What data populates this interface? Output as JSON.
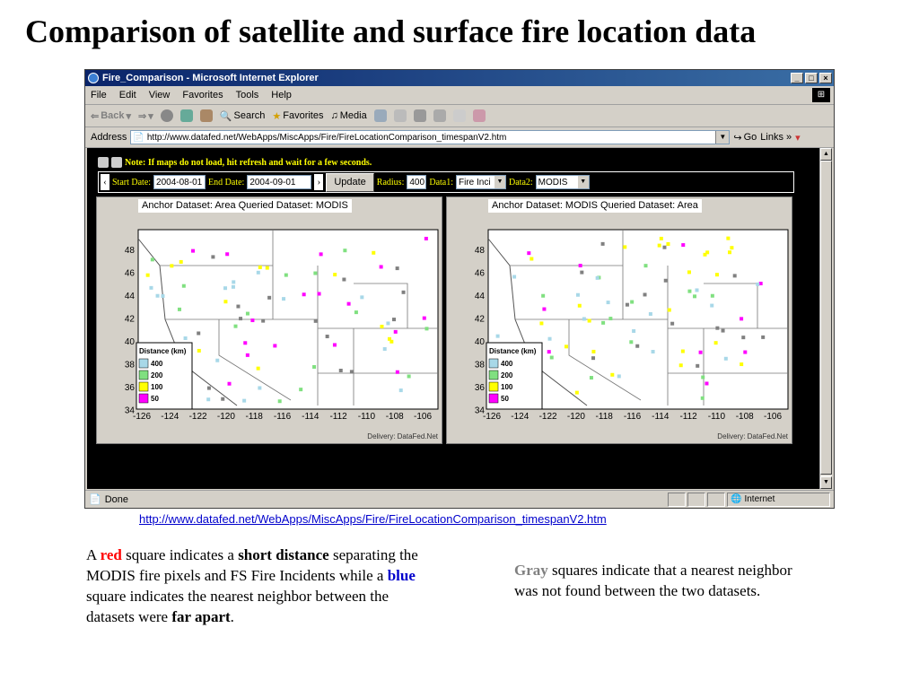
{
  "slide": {
    "title": "Comparison of satellite and surface fire location data",
    "caption_url": "http://www.datafed.net/WebApps/MiscApps/Fire/FireLocationComparison_timespanV2.htm"
  },
  "browser": {
    "window_title": "Fire_Comparison - Microsoft Internet Explorer",
    "menu": [
      "File",
      "Edit",
      "View",
      "Favorites",
      "Tools",
      "Help"
    ],
    "toolbar": {
      "back": "Back",
      "search": "Search",
      "favorites": "Favorites",
      "media": "Media"
    },
    "address_label": "Address",
    "address_value": "http://www.datafed.net/WebApps/MiscApps/Fire/FireLocationComparison_timespanV2.htm",
    "go_label": "Go",
    "links_label": "Links",
    "status_text": "Done",
    "zone_text": "Internet"
  },
  "page": {
    "note": "Note: If maps do not load, hit refresh and wait for a few seconds.",
    "controls": {
      "start_label": "Start Date:",
      "start_value": "2004-08-01",
      "end_label": "End Date:",
      "end_value": "2004-09-01",
      "update_label": "Update",
      "radius_label": "Radius:",
      "radius_value": "400",
      "data1_label": "Data1:",
      "data1_value": "Fire Inci",
      "data2_label": "Data2:",
      "data2_value": "MODIS"
    },
    "maps": [
      {
        "title": "Anchor Dataset: Area Queried Dataset: MODIS",
        "delivery": "Delivery: DataFed.Net"
      },
      {
        "title": "Anchor Dataset: MODIS Queried Dataset: Area",
        "delivery": "Delivery: DataFed.Net"
      }
    ],
    "map_axes": {
      "lat_ticks": [
        "48",
        "46",
        "44",
        "42",
        "40",
        "38",
        "36",
        "34"
      ],
      "lon_ticks": [
        "-126",
        "-124",
        "-122",
        "-120",
        "-118",
        "-116",
        "-114",
        "-112",
        "-110",
        "-108",
        "-106"
      ]
    },
    "legend": {
      "title": "Distance (km)",
      "items": [
        {
          "label": "400",
          "color": "#a8d8e8"
        },
        {
          "label": "200",
          "color": "#80e080"
        },
        {
          "label": "100",
          "color": "#ffff00"
        },
        {
          "label": "50",
          "color": "#ff00ff"
        }
      ]
    }
  },
  "text": {
    "left": {
      "p1": "A ",
      "red": "red",
      "p2": " square indicates a ",
      "short_distance": "short distance",
      "p3": " separating the MODIS fire pixels and FS Fire Incidents while a ",
      "blue": "blue",
      "p4": " square indicates the nearest neighbor between the datasets were ",
      "far_apart": "far apart",
      "p5": "."
    },
    "right": {
      "gray": "Gray",
      "p1": " squares indicate that a nearest neighbor was not found between the two datasets."
    }
  }
}
